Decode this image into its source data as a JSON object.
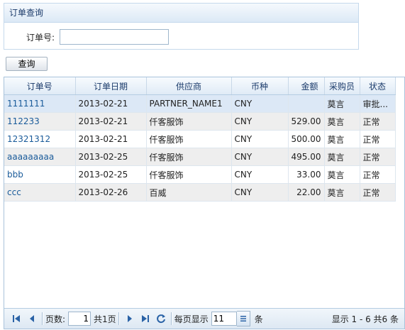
{
  "panel": {
    "title": "订单查询",
    "order_label": "订单号:",
    "order_value": "",
    "query_button": "查询"
  },
  "grid": {
    "columns": [
      "订单号",
      "订单日期",
      "供应商",
      "币种",
      "金额",
      "采购员",
      "状态"
    ],
    "rows": [
      [
        "1111111",
        "2013-02-21",
        "PARTNER_NAME1",
        "CNY",
        "",
        "莫言",
        "审批..."
      ],
      [
        "112233",
        "2013-02-21",
        "仟客服饰",
        "CNY",
        "529.00",
        "莫言",
        "正常"
      ],
      [
        "12321312",
        "2013-02-21",
        "仟客服饰",
        "CNY",
        "500.00",
        "莫言",
        "正常"
      ],
      [
        "aaaaaaaaa",
        "2013-02-25",
        "仟客服饰",
        "CNY",
        "495.00",
        "莫言",
        "正常"
      ],
      [
        "bbb",
        "2013-02-25",
        "仟客服饰",
        "CNY",
        "33.00",
        "莫言",
        "正常"
      ],
      [
        "ccc",
        "2013-02-26",
        "百威",
        "CNY",
        "22.00",
        "莫言",
        "正常"
      ]
    ]
  },
  "pager": {
    "page_label": "页数:",
    "page_value": "1",
    "total_pages": "共1页",
    "per_page_label": "每页显示",
    "per_page_value": "11",
    "per_page_unit": "条",
    "info": "显示 1 - 6 共6 条"
  }
}
